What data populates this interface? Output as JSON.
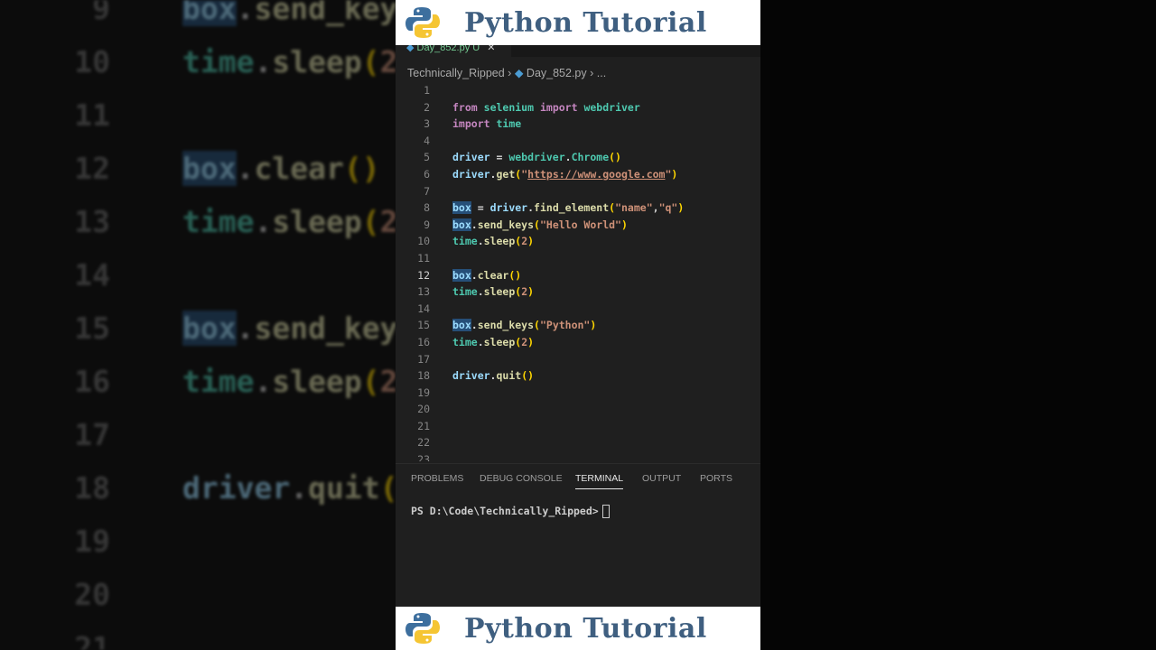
{
  "brand": {
    "title": "Python Tutorial"
  },
  "editor": {
    "tab": {
      "filename": "Day_852.py",
      "status": "U"
    },
    "breadcrumb": [
      "Technically_Ripped",
      "Day_852.py",
      "..."
    ],
    "current_line": 12,
    "lines": [
      {
        "n": "1",
        "tokens": []
      },
      {
        "n": "2",
        "tokens": [
          {
            "t": "from",
            "c": "kw"
          },
          {
            "t": " "
          },
          {
            "t": "selenium",
            "c": "mod"
          },
          {
            "t": " "
          },
          {
            "t": "import",
            "c": "kw"
          },
          {
            "t": " "
          },
          {
            "t": "webdriver",
            "c": "mod"
          }
        ]
      },
      {
        "n": "3",
        "tokens": [
          {
            "t": "import",
            "c": "kw"
          },
          {
            "t": " "
          },
          {
            "t": "time",
            "c": "mod"
          }
        ]
      },
      {
        "n": "4",
        "tokens": []
      },
      {
        "n": "5",
        "tokens": [
          {
            "t": "driver",
            "c": "var"
          },
          {
            "t": " = ",
            "c": "op"
          },
          {
            "t": "webdriver",
            "c": "mod"
          },
          {
            "t": ".",
            "c": "op"
          },
          {
            "t": "Chrome",
            "c": "mod"
          },
          {
            "t": "()",
            "c": "p"
          }
        ]
      },
      {
        "n": "6",
        "tokens": [
          {
            "t": "driver",
            "c": "var"
          },
          {
            "t": ".",
            "c": "op"
          },
          {
            "t": "get",
            "c": "fn"
          },
          {
            "t": "(",
            "c": "p"
          },
          {
            "t": "\"",
            "c": "str"
          },
          {
            "t": "https://www.google.com",
            "c": "str url"
          },
          {
            "t": "\"",
            "c": "str"
          },
          {
            "t": ")",
            "c": "p"
          }
        ]
      },
      {
        "n": "7",
        "tokens": []
      },
      {
        "n": "8",
        "tokens": [
          {
            "t": "box",
            "c": "var hl"
          },
          {
            "t": " = ",
            "c": "op"
          },
          {
            "t": "driver",
            "c": "var"
          },
          {
            "t": ".",
            "c": "op"
          },
          {
            "t": "find_element",
            "c": "fn"
          },
          {
            "t": "(",
            "c": "p"
          },
          {
            "t": "\"name\"",
            "c": "str"
          },
          {
            "t": ",",
            "c": "op"
          },
          {
            "t": "\"q\"",
            "c": "str"
          },
          {
            "t": ")",
            "c": "p"
          }
        ]
      },
      {
        "n": "9",
        "tokens": [
          {
            "t": "box",
            "c": "var hl"
          },
          {
            "t": ".",
            "c": "op"
          },
          {
            "t": "send_keys",
            "c": "fn"
          },
          {
            "t": "(",
            "c": "p"
          },
          {
            "t": "\"Hello World\"",
            "c": "str"
          },
          {
            "t": ")",
            "c": "p"
          }
        ]
      },
      {
        "n": "10",
        "tokens": [
          {
            "t": "time",
            "c": "mod"
          },
          {
            "t": ".",
            "c": "op"
          },
          {
            "t": "sleep",
            "c": "fn"
          },
          {
            "t": "(",
            "c": "p"
          },
          {
            "t": "2",
            "c": "str"
          },
          {
            "t": ")",
            "c": "p"
          }
        ]
      },
      {
        "n": "11",
        "tokens": []
      },
      {
        "n": "12",
        "tokens": [
          {
            "t": "box",
            "c": "var hl"
          },
          {
            "t": ".",
            "c": "op"
          },
          {
            "t": "clear",
            "c": "fn"
          },
          {
            "t": "()",
            "c": "p"
          }
        ]
      },
      {
        "n": "13",
        "tokens": [
          {
            "t": "time",
            "c": "mod"
          },
          {
            "t": ".",
            "c": "op"
          },
          {
            "t": "sleep",
            "c": "fn"
          },
          {
            "t": "(",
            "c": "p"
          },
          {
            "t": "2",
            "c": "str"
          },
          {
            "t": ")",
            "c": "p"
          }
        ]
      },
      {
        "n": "14",
        "tokens": []
      },
      {
        "n": "15",
        "tokens": [
          {
            "t": "box",
            "c": "var hl"
          },
          {
            "t": ".",
            "c": "op"
          },
          {
            "t": "send_keys",
            "c": "fn"
          },
          {
            "t": "(",
            "c": "p"
          },
          {
            "t": "\"Python\"",
            "c": "str"
          },
          {
            "t": ")",
            "c": "p"
          }
        ]
      },
      {
        "n": "16",
        "tokens": [
          {
            "t": "time",
            "c": "mod"
          },
          {
            "t": ".",
            "c": "op"
          },
          {
            "t": "sleep",
            "c": "fn"
          },
          {
            "t": "(",
            "c": "p"
          },
          {
            "t": "2",
            "c": "str"
          },
          {
            "t": ")",
            "c": "p"
          }
        ]
      },
      {
        "n": "17",
        "tokens": []
      },
      {
        "n": "18",
        "tokens": [
          {
            "t": "driver",
            "c": "var"
          },
          {
            "t": ".",
            "c": "op"
          },
          {
            "t": "quit",
            "c": "fn"
          },
          {
            "t": "()",
            "c": "p"
          }
        ]
      },
      {
        "n": "19",
        "tokens": []
      },
      {
        "n": "20",
        "tokens": []
      },
      {
        "n": "21",
        "tokens": []
      },
      {
        "n": "22",
        "tokens": []
      },
      {
        "n": "23",
        "tokens": []
      }
    ]
  },
  "panel": {
    "tabs": [
      "PROBLEMS",
      "DEBUG CONSOLE",
      "TERMINAL",
      "OUTPUT",
      "PORTS"
    ],
    "active_tab": "TERMINAL",
    "terminal_prompt": "PS D:\\Code\\Technically_Ripped>"
  }
}
